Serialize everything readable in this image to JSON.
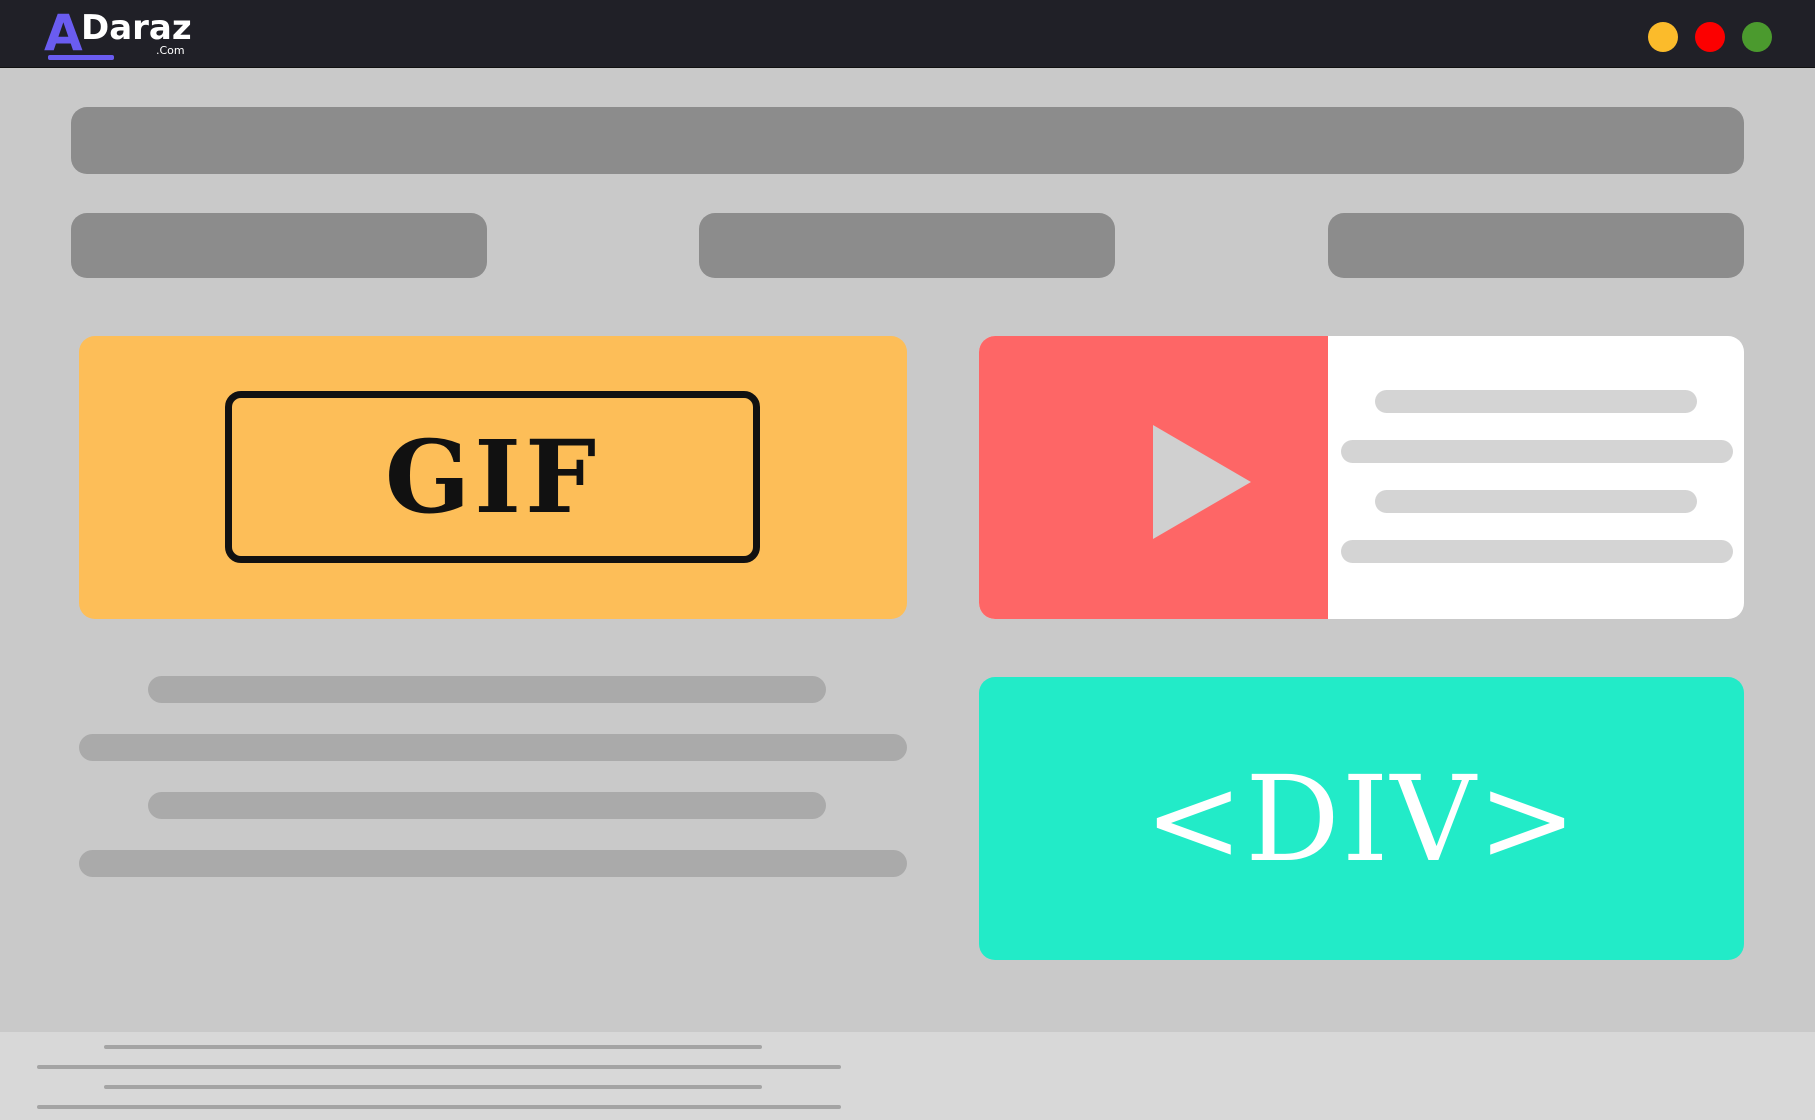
{
  "app": {
    "logo_letter": "A",
    "logo_word": "Daraz",
    "logo_tld": ".Com"
  },
  "window_controls": [
    {
      "name": "minimize-dot",
      "color": "#fbbb2b"
    },
    {
      "name": "close-dot",
      "color": "#fc0000"
    },
    {
      "name": "maximize-dot",
      "color": "#4b9a2e"
    }
  ],
  "gif_card": {
    "label": "GIF",
    "color": "#fdbe58"
  },
  "video_card": {
    "icon": "play-icon",
    "color": "#fe6666"
  },
  "div_card": {
    "label": "<DIV>",
    "color": "#22ebc8"
  }
}
